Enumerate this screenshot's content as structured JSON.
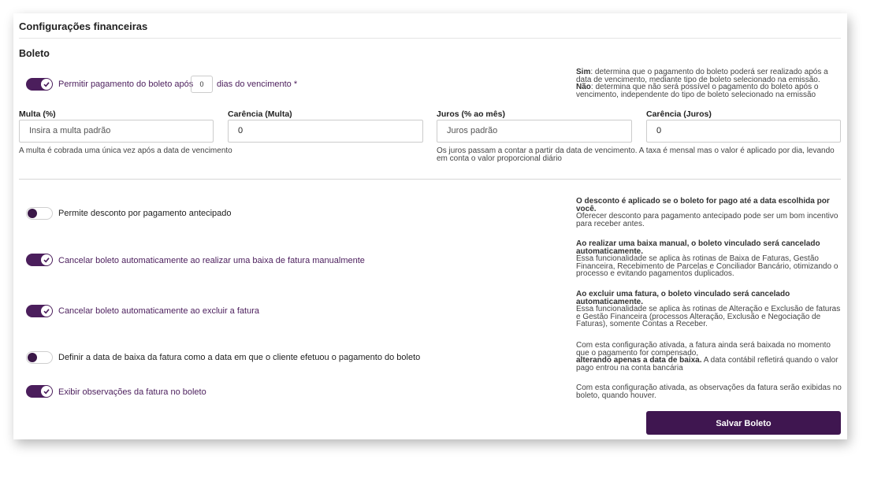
{
  "header": {
    "title": "Configurações financeiras"
  },
  "boleto": {
    "section_title": "Boleto",
    "allow_after": {
      "label_before": "Permitir pagamento do boleto após",
      "days_value": "0",
      "label_after": "dias do vencimento *",
      "enabled": true,
      "help_sim_key": "Sim",
      "help_sim_text": ": determina que o pagamento do boleto poderá ser realizado após a data de vencimento, mediante tipo de boleto selecionado na emissão.",
      "help_nao_key": "Não",
      "help_nao_text": ": determina que não será possível o pagamento do boleto após o vencimento, independente do tipo de boleto selecionado na emissão"
    },
    "fields": {
      "multa_label": "Multa (%)",
      "multa_placeholder": "Insira a multa padrão",
      "carencia_multa_label": "Carência (Multa)",
      "carencia_multa_value": "0",
      "juros_label": "Juros (% ao mês)",
      "juros_placeholder": "Juros padrão",
      "carencia_juros_label": "Carência (Juros)",
      "carencia_juros_value": "0",
      "multa_hint": "A multa é cobrada uma única vez após a data de vencimento",
      "juros_hint": "Os juros passam a contar a partir da data de vencimento. A taxa é mensal mas o valor é aplicado por dia, levando em conta o valor proporcional diário"
    },
    "options": [
      {
        "label": "Permite desconto por pagamento antecipado",
        "enabled": false,
        "help_bold": "O desconto é aplicado se o boleto for pago até a data escolhida por você.",
        "help_text": "Oferecer desconto para pagamento antecipado pode ser um bom incentivo para receber antes."
      },
      {
        "label": "Cancelar boleto automaticamente ao realizar uma baixa de fatura manualmente",
        "enabled": true,
        "help_bold": "Ao realizar uma baixa manual, o boleto vinculado será cancelado automaticamente.",
        "help_text": "Essa funcionalidade se aplica às rotinas de Baixa de Faturas, Gestão Financeira, Recebimento de Parcelas e Conciliador Bancário, otimizando o processo e evitando pagamentos duplicados."
      },
      {
        "label": "Cancelar boleto automaticamente ao excluir a fatura",
        "enabled": true,
        "help_bold": "Ao excluir uma fatura, o boleto vinculado será cancelado automaticamente.",
        "help_text": "Essa funcionalidade se aplica às rotinas de Alteração e Exclusão de faturas e Gestão Financeira (processos Alteração, Exclusão e Negociação de Faturas), somente Contas a Receber."
      },
      {
        "label": "Definir a data de baixa da fatura como a data em que o cliente efetuou o pagamento do boleto",
        "enabled": false,
        "help_pre": "Com esta configuração ativada, a fatura ainda será baixada no momento que o pagamento for compensado,",
        "help_bold": "alterando apenas a data de baixa.",
        "help_post": " A data contábil refletirá quando o valor pago entrou na conta bancária"
      },
      {
        "label": "Exibir observações da fatura no boleto",
        "enabled": true,
        "help_text": "Com esta configuração ativada, as observações da fatura serão exibidas no boleto, quando houver."
      }
    ],
    "save_label": "Salvar Boleto"
  },
  "colors": {
    "accent": "#4b1e5c",
    "button": "#3f1650"
  },
  "icons": {
    "toggle_check": "check-icon"
  }
}
